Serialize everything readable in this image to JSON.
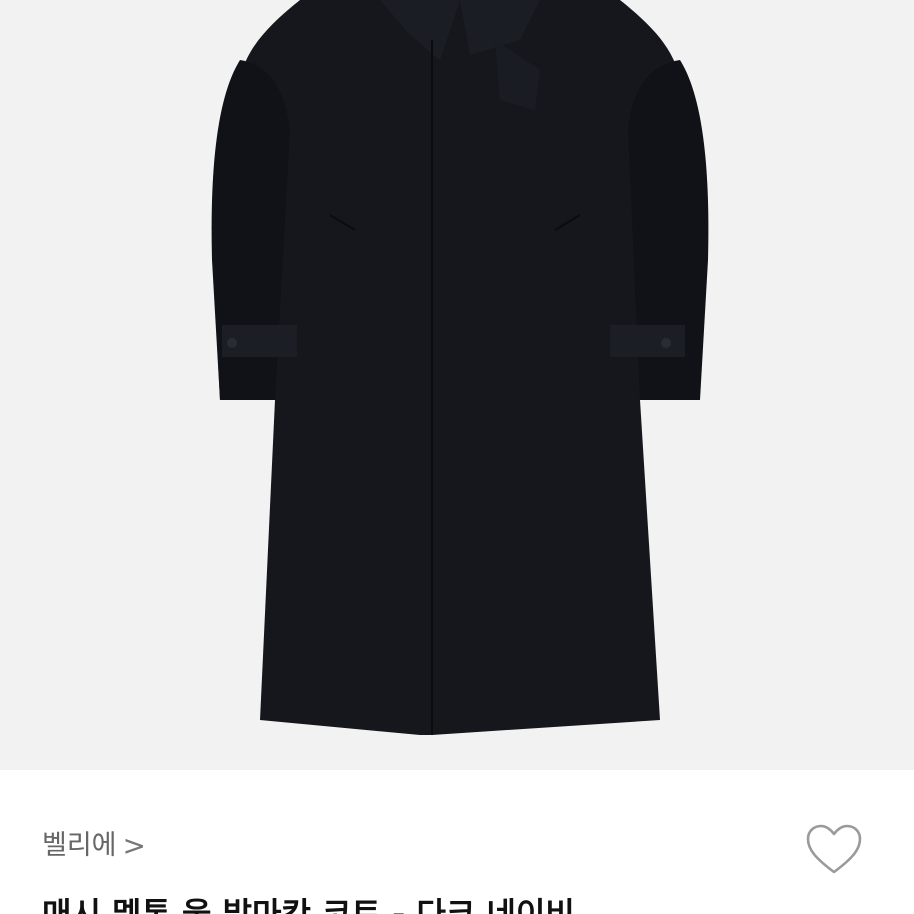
{
  "product": {
    "image_icon": "coat-photo",
    "image_bg": "#f2f2f2",
    "garment_color": "#15171d"
  },
  "brand": {
    "name": "벨리에",
    "chevron": ">"
  },
  "wishlist": {
    "icon": "heart-outline-icon"
  },
  "title": "매시 멜톤 울 발마칸 코트 - 다크 네이비"
}
